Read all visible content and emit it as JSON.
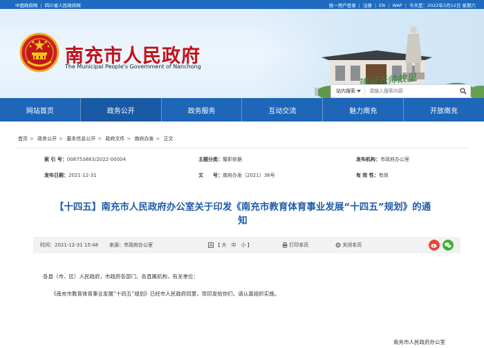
{
  "topbar": {
    "links_left": [
      "中国政府网",
      "四川省人民政府网"
    ],
    "links_right": [
      "统一用户登录",
      "注册",
      "EN",
      "WAP"
    ],
    "date": "今天是：2022年2月12日 星期六"
  },
  "header": {
    "site_title": "南充市人民政府",
    "site_subtitle": "The Municipal People's Government of Nanchong",
    "calligraphy": "建设元帅故里",
    "search": {
      "scope": "站内搜索",
      "placeholder": "请输入搜索内容"
    }
  },
  "nav": [
    "网站首页",
    "政务公开",
    "政务服务",
    "互动交流",
    "魅力南充",
    "开放南充"
  ],
  "breadcrumb": [
    "首页",
    "政务公开",
    "基本信息公开",
    "政府文件",
    "南府办发",
    "正文"
  ],
  "meta": {
    "index_label": "索 引 号：",
    "index": "008753883/2022-00004",
    "topic_label": "主题分类：",
    "topic": "履职依据",
    "issuer_label": "发布机构：",
    "issuer": "市政府办公室",
    "date_label": "发布日期：",
    "date": "2021-12-31",
    "docno_label": "文　　号：",
    "docno": "南府办发〔2021〕36号",
    "validity_label": "有 效 性：",
    "validity": "有效"
  },
  "doc_title_line1": "【十四五】南充市人民政府办公室关于印发《南充市教育体育事业发展“十四五”规划》的通",
  "doc_title_line2": "知",
  "toolbar": {
    "time": "时间：2021-12-31 15:48",
    "source": "来源：市政府办公室",
    "font": "【 大　中　小 】",
    "print": "打印本页",
    "close": "关闭本页"
  },
  "body": {
    "salutation": "各县（市、区）人民政府，市政府各部门、各直属机构，有关单位：",
    "para1": "《南充市教育体育事业发展“十四五”规划》已经市人民政府同意，现印发给你们，请认真组织实施。",
    "signoff": "南充市人民政府办公室"
  },
  "colors": {
    "brand_red": "#c1121a",
    "nav_blue": "#1d66b8",
    "title_blue": "#1f5ca8"
  }
}
